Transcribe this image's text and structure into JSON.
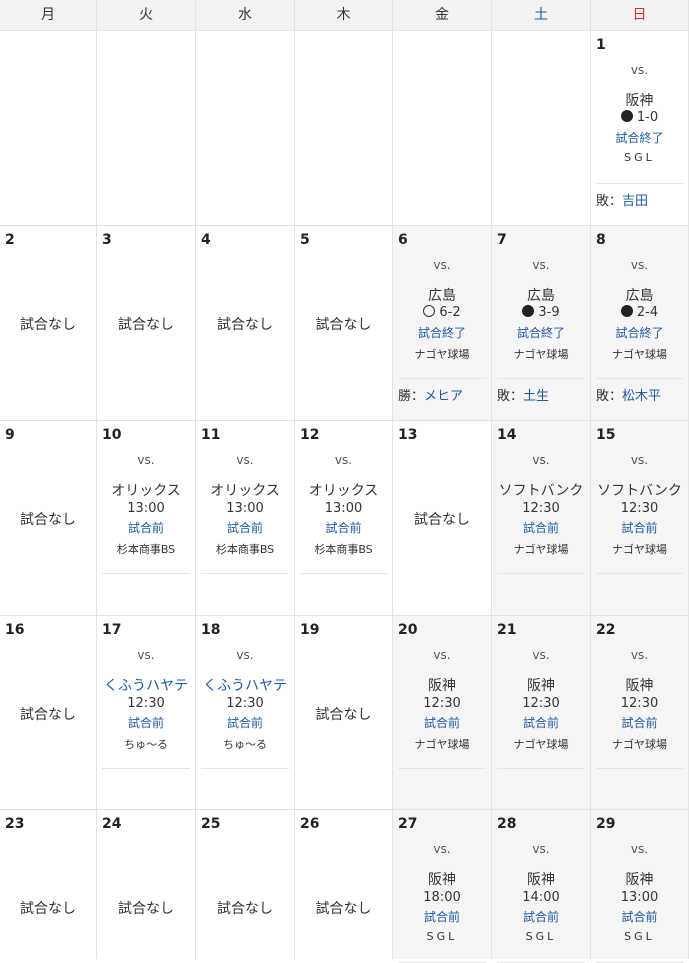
{
  "weekdays": [
    "月",
    "火",
    "水",
    "木",
    "金",
    "土",
    "日"
  ],
  "weeks": [
    [
      {
        "day": ""
      },
      {
        "day": ""
      },
      {
        "day": ""
      },
      {
        "day": ""
      },
      {
        "day": ""
      },
      {
        "day": ""
      },
      {
        "day": "1",
        "vs": "vs.",
        "opponent": "阪神",
        "marker": "lose",
        "score": "1-0",
        "status": "試合終了",
        "venue": "SGL",
        "pitcher_label": "敗：",
        "pitcher": "吉田"
      }
    ],
    [
      {
        "day": "2",
        "note": "試合なし"
      },
      {
        "day": "3",
        "note": "試合なし"
      },
      {
        "day": "4",
        "note": "試合なし"
      },
      {
        "day": "5",
        "note": "試合なし"
      },
      {
        "day": "6",
        "home": true,
        "vs": "vs.",
        "opponent": "広島",
        "marker": "win",
        "score": "6-2",
        "status": "試合終了",
        "venue": "ナゴヤ球場",
        "pitcher_label": "勝：",
        "pitcher": "メヒア"
      },
      {
        "day": "7",
        "home": true,
        "vs": "vs.",
        "opponent": "広島",
        "marker": "lose",
        "score": "3-9",
        "status": "試合終了",
        "venue": "ナゴヤ球場",
        "pitcher_label": "敗：",
        "pitcher": "土生"
      },
      {
        "day": "8",
        "home": true,
        "vs": "vs.",
        "opponent": "広島",
        "marker": "lose",
        "score": "2-4",
        "status": "試合終了",
        "venue": "ナゴヤ球場",
        "pitcher_label": "敗：",
        "pitcher": "松木平"
      }
    ],
    [
      {
        "day": "9",
        "note": "試合なし"
      },
      {
        "day": "10",
        "vs": "vs.",
        "opponent": "オリックス",
        "time": "13:00",
        "status": "試合前",
        "venue": "杉本商事BS"
      },
      {
        "day": "11",
        "vs": "vs.",
        "opponent": "オリックス",
        "time": "13:00",
        "status": "試合前",
        "venue": "杉本商事BS"
      },
      {
        "day": "12",
        "vs": "vs.",
        "opponent": "オリックス",
        "time": "13:00",
        "status": "試合前",
        "venue": "杉本商事BS"
      },
      {
        "day": "13",
        "note": "試合なし"
      },
      {
        "day": "14",
        "home": true,
        "vs": "vs.",
        "opponent": "ソフトバンク",
        "time": "12:30",
        "status": "試合前",
        "venue": "ナゴヤ球場"
      },
      {
        "day": "15",
        "home": true,
        "vs": "vs.",
        "opponent": "ソフトバンク",
        "time": "12:30",
        "status": "試合前",
        "venue": "ナゴヤ球場"
      }
    ],
    [
      {
        "day": "16",
        "note": "試合なし"
      },
      {
        "day": "17",
        "vs": "vs.",
        "opponent": "くふうハヤテ",
        "opp_link": true,
        "time": "12:30",
        "status": "試合前",
        "venue": "ちゅ～る"
      },
      {
        "day": "18",
        "vs": "vs.",
        "opponent": "くふうハヤテ",
        "opp_link": true,
        "time": "12:30",
        "status": "試合前",
        "venue": "ちゅ～る"
      },
      {
        "day": "19",
        "note": "試合なし"
      },
      {
        "day": "20",
        "home": true,
        "vs": "vs.",
        "opponent": "阪神",
        "time": "12:30",
        "status": "試合前",
        "venue": "ナゴヤ球場"
      },
      {
        "day": "21",
        "home": true,
        "vs": "vs.",
        "opponent": "阪神",
        "time": "12:30",
        "status": "試合前",
        "venue": "ナゴヤ球場"
      },
      {
        "day": "22",
        "home": true,
        "vs": "vs.",
        "opponent": "阪神",
        "time": "12:30",
        "status": "試合前",
        "venue": "ナゴヤ球場"
      }
    ],
    [
      {
        "day": "23",
        "note": "試合なし"
      },
      {
        "day": "24",
        "note": "試合なし"
      },
      {
        "day": "25",
        "note": "試合なし"
      },
      {
        "day": "26",
        "note": "試合なし"
      },
      {
        "day": "27",
        "home": true,
        "vs": "vs.",
        "opponent": "阪神",
        "time": "18:00",
        "status": "試合前",
        "venue": "SGL"
      },
      {
        "day": "28",
        "home": true,
        "vs": "vs.",
        "opponent": "阪神",
        "time": "14:00",
        "status": "試合前",
        "venue": "SGL"
      },
      {
        "day": "29",
        "home": true,
        "vs": "vs.",
        "opponent": "阪神",
        "time": "13:00",
        "status": "試合前",
        "venue": "SGL"
      }
    ]
  ]
}
